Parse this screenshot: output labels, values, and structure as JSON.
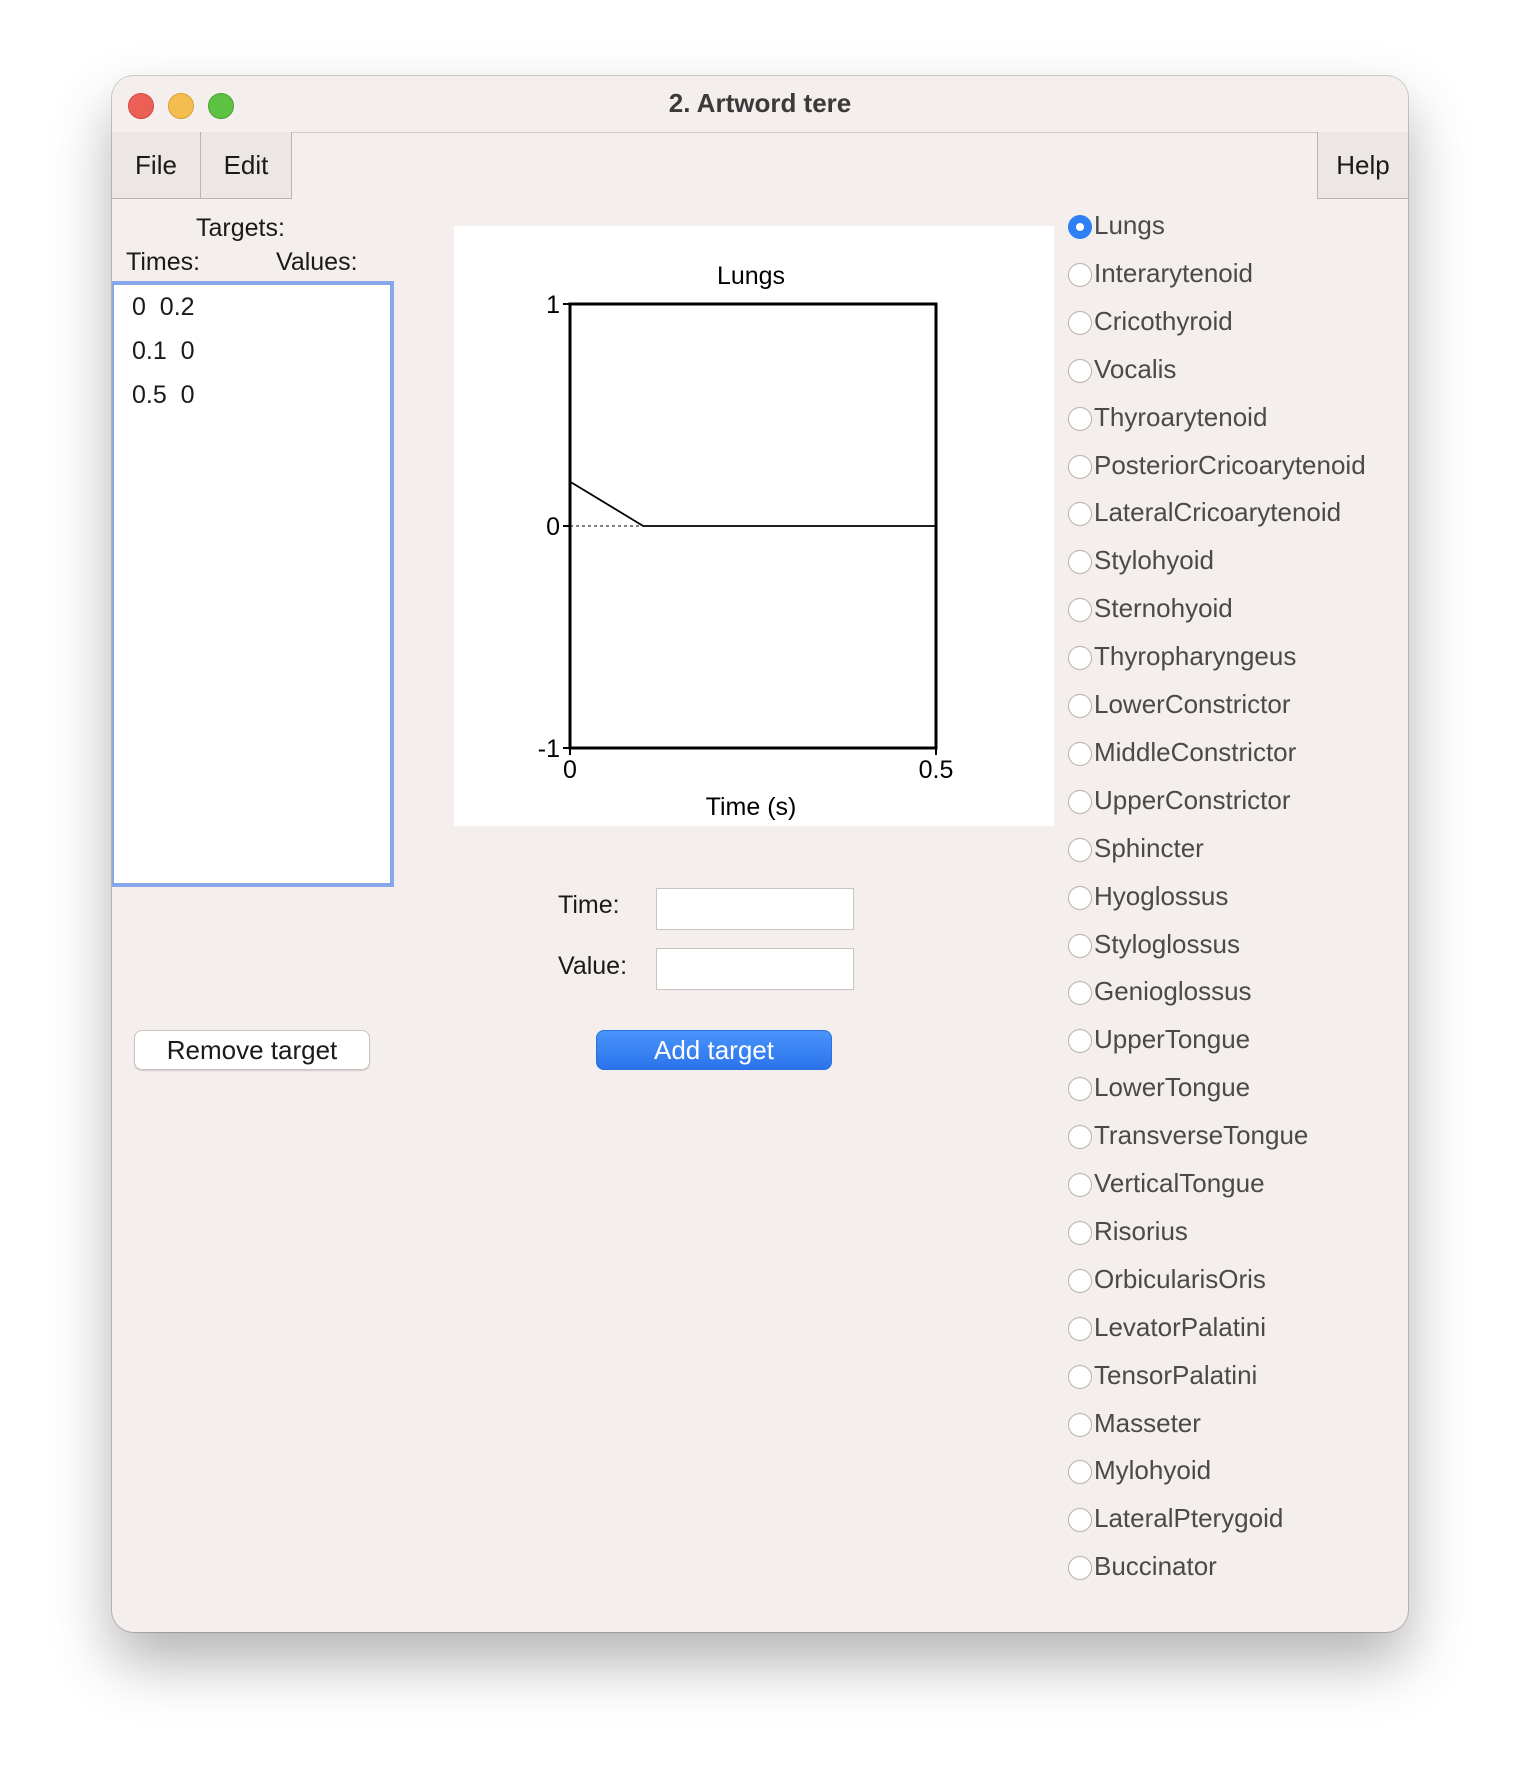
{
  "window": {
    "title": "2. Artword tere"
  },
  "menu": {
    "file": "File",
    "edit": "Edit",
    "help": "Help"
  },
  "targets": {
    "header": "Targets:",
    "times_label": "Times:",
    "values_label": "Values:",
    "rows": [
      "0  0.2",
      "0.1  0",
      "0.5  0"
    ]
  },
  "buttons": {
    "remove": "Remove target",
    "add": "Add target"
  },
  "fields": {
    "time_label": "Time:",
    "value_label": "Value:",
    "time_value": "",
    "value_value": ""
  },
  "chart_data": {
    "type": "line",
    "title": "Lungs",
    "xlabel": "Time (s)",
    "ylabel": "",
    "xlim": [
      0,
      0.5
    ],
    "ylim": [
      -1,
      1
    ],
    "x_ticks": [
      "0",
      "0.5"
    ],
    "y_ticks": [
      "1",
      "0",
      "-1"
    ],
    "series": [
      {
        "x": [
          0,
          0.1,
          0.5
        ],
        "y": [
          0.2,
          0,
          0
        ]
      }
    ],
    "zero_line": "dotted"
  },
  "muscles": {
    "selected": "Lungs",
    "items": [
      "Lungs",
      "Interarytenoid",
      "Cricothyroid",
      "Vocalis",
      "Thyroarytenoid",
      "PosteriorCricoarytenoid",
      "LateralCricoarytenoid",
      "Stylohyoid",
      "Sternohyoid",
      "Thyropharyngeus",
      "LowerConstrictor",
      "MiddleConstrictor",
      "UpperConstrictor",
      "Sphincter",
      "Hyoglossus",
      "Styloglossus",
      "Genioglossus",
      "UpperTongue",
      "LowerTongue",
      "TransverseTongue",
      "VerticalTongue",
      "Risorius",
      "OrbicularisOris",
      "LevatorPalatini",
      "TensorPalatini",
      "Masseter",
      "Mylohyoid",
      "LateralPterygoid",
      "Buccinator"
    ]
  }
}
